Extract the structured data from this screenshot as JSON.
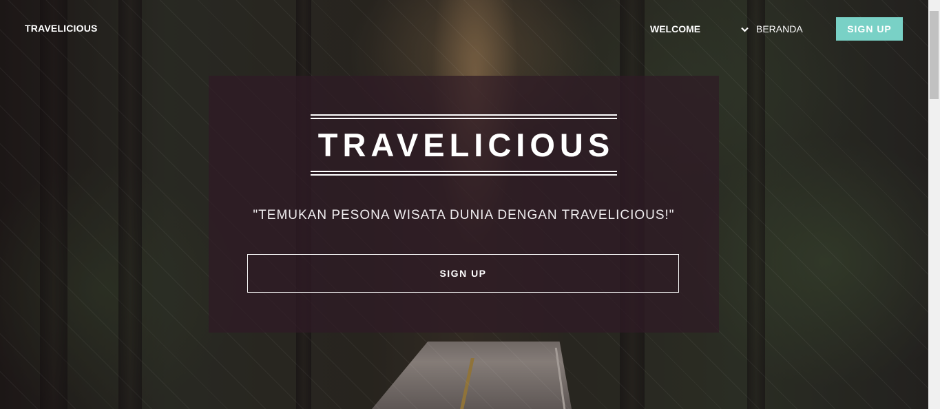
{
  "nav": {
    "brand": "TRAVELICIOUS",
    "welcome": "WELCOME",
    "beranda": "BERANDA",
    "signup": "SIGN UP",
    "signup_color": "#79d1c6"
  },
  "hero": {
    "title": "TRAVELICIOUS",
    "tagline": "\"TEMUKAN PESONA WISATA DUNIA DENGAN TRAVELICIOUS!\"",
    "signup": "SIGN UP"
  },
  "icons": {
    "dropdown": "chevron-down-icon"
  }
}
